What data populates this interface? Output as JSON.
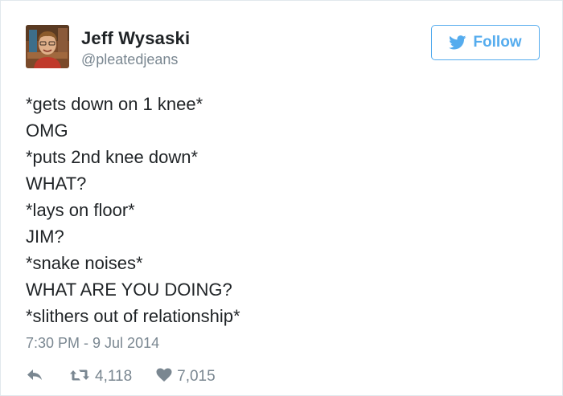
{
  "author": {
    "name": "Jeff Wysaski",
    "handle": "@pleatedjeans"
  },
  "follow_button": {
    "label": "Follow",
    "icon": "twitter-bird-icon"
  },
  "tweet": {
    "lines": [
      "*gets down on 1 knee*",
      "OMG",
      "*puts 2nd knee down*",
      "WHAT?",
      "*lays on floor*",
      "JIM?",
      "*snake noises*",
      "WHAT ARE YOU DOING?",
      "*slithers out of relationship*"
    ],
    "timestamp": "7:30 PM - 9 Jul 2014"
  },
  "actions": {
    "reply": {
      "icon": "reply-icon"
    },
    "retweet": {
      "icon": "retweet-icon",
      "count": "4,118"
    },
    "like": {
      "icon": "heart-icon",
      "count": "7,015"
    }
  },
  "colors": {
    "accent": "#55acee",
    "text": "#1f2326",
    "muted": "#7a8791",
    "border": "#e1e8ed"
  }
}
